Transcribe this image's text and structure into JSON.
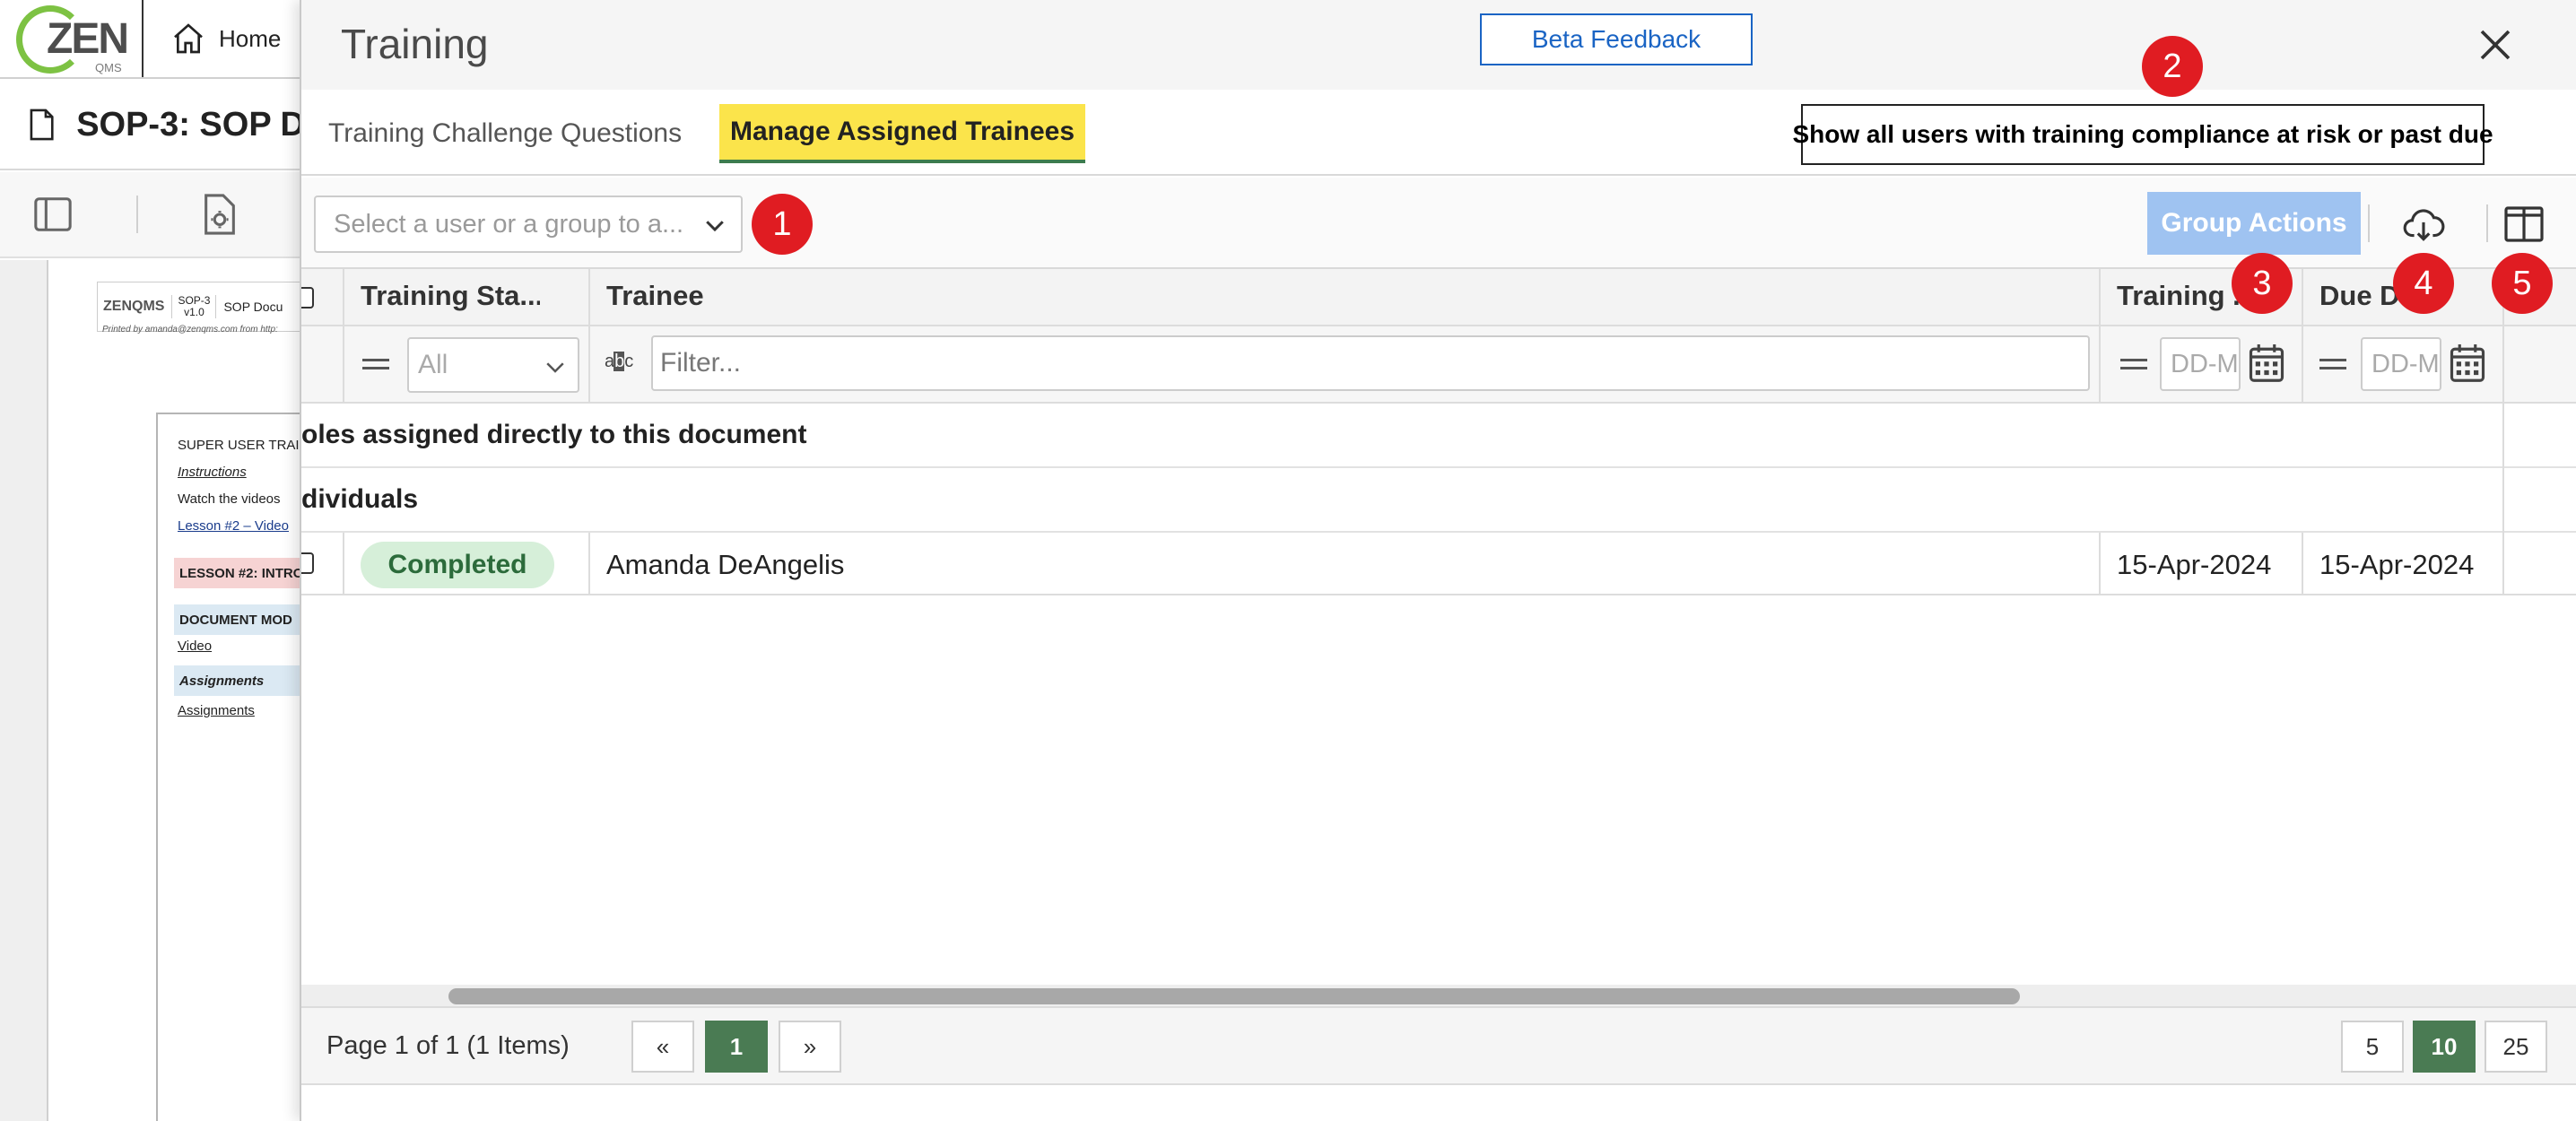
{
  "app": {
    "logo_text": "ZEN",
    "logo_sub": "QMS",
    "home_label": "Home",
    "doc_title": "SOP-3: SOP D",
    "preview": {
      "logo": "ZENQMS",
      "doc_code": "SOP-3",
      "doc_version": "v1.0",
      "doc_name": "SOP Docu",
      "printed_by": "Printed by amanda@zenqms.com from http:",
      "heading": "SUPER USER TRAI",
      "instructions": "Instructions",
      "watch": "Watch the videos",
      "lesson_link": "Lesson #2 – Video",
      "lesson_band": "LESSON #2: INTRO",
      "doc_band": "DOCUMENT MOD",
      "video_link": "Video",
      "assignments_band": "Assignments",
      "assignments_link": "Assignments"
    }
  },
  "modal": {
    "title": "Training",
    "beta_feedback": "Beta Feedback",
    "close_icon": "close-icon",
    "tabs": [
      {
        "label": "Training Challenge Questions",
        "active": false
      },
      {
        "label": "Manage Assigned Trainees",
        "active": true
      }
    ],
    "risk_button": "Show all users with training compliance at risk or past due",
    "user_select_placeholder": "Select a user or a group to a...",
    "group_actions": "Group Actions",
    "markers": [
      "1",
      "2",
      "3",
      "4",
      "5"
    ]
  },
  "grid": {
    "columns": [
      "Training Sta...",
      "Trainee",
      "Training ...",
      "Due Da..."
    ],
    "status_filter_value": "All",
    "filter_placeholder": "Filter...",
    "date_placeholder": "DD-MMM-YYYY",
    "abc_label": "abc",
    "groups": [
      "oles assigned directly to this document",
      "dividuals"
    ],
    "rows": [
      {
        "status": "Completed",
        "trainee": "Amanda DeAngelis",
        "training_date": "15-Apr-2024",
        "due_date": "15-Apr-2024"
      }
    ]
  },
  "pager": {
    "info": "Page 1 of 1 (1 Items)",
    "first": "«",
    "current": "1",
    "last": "»",
    "page_sizes": [
      "5",
      "10",
      "25"
    ],
    "active_size": "10"
  },
  "colors": {
    "accent_blue": "#1a64c4",
    "active_tab": "#fbe44b",
    "marker_red": "#e01c22",
    "pager_green": "#4a7b53",
    "badge_green": "#d6efd9"
  }
}
